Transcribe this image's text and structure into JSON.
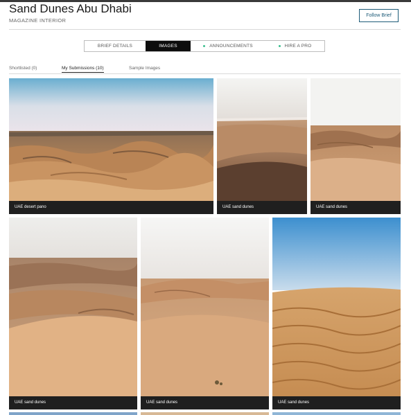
{
  "header": {
    "title": "Sand Dunes Abu Dhabi",
    "subtitle": "MAGAZINE INTERIOR",
    "follow_label": "Follow Brief"
  },
  "tabs": [
    {
      "label": "BRIEF DETAILS",
      "active": false,
      "dot": false
    },
    {
      "label": "IMAGES",
      "active": true,
      "dot": false
    },
    {
      "label": "ANNOUNCEMENTS",
      "active": false,
      "dot": true
    },
    {
      "label": "HIRE A PRO",
      "active": false,
      "dot": true
    }
  ],
  "subtabs": [
    {
      "label": "Shortlisted (0)",
      "active": false
    },
    {
      "label": "My Submissions (10)",
      "active": true
    },
    {
      "label": "Sample Images",
      "active": false
    }
  ],
  "images": [
    {
      "caption": "UAE desert pano"
    },
    {
      "caption": "UAE sand dunes"
    },
    {
      "caption": "UAE sand dunes"
    },
    {
      "caption": "UAE sand dunes"
    },
    {
      "caption": "UAE sand dunes"
    },
    {
      "caption": "UAE sand dunes"
    }
  ],
  "colors": {
    "accent": "#1d5b78",
    "caption_bar": "#1f1f1f",
    "active_tab": "#0d0d0d",
    "tab_dot": "#3bbf8f"
  }
}
